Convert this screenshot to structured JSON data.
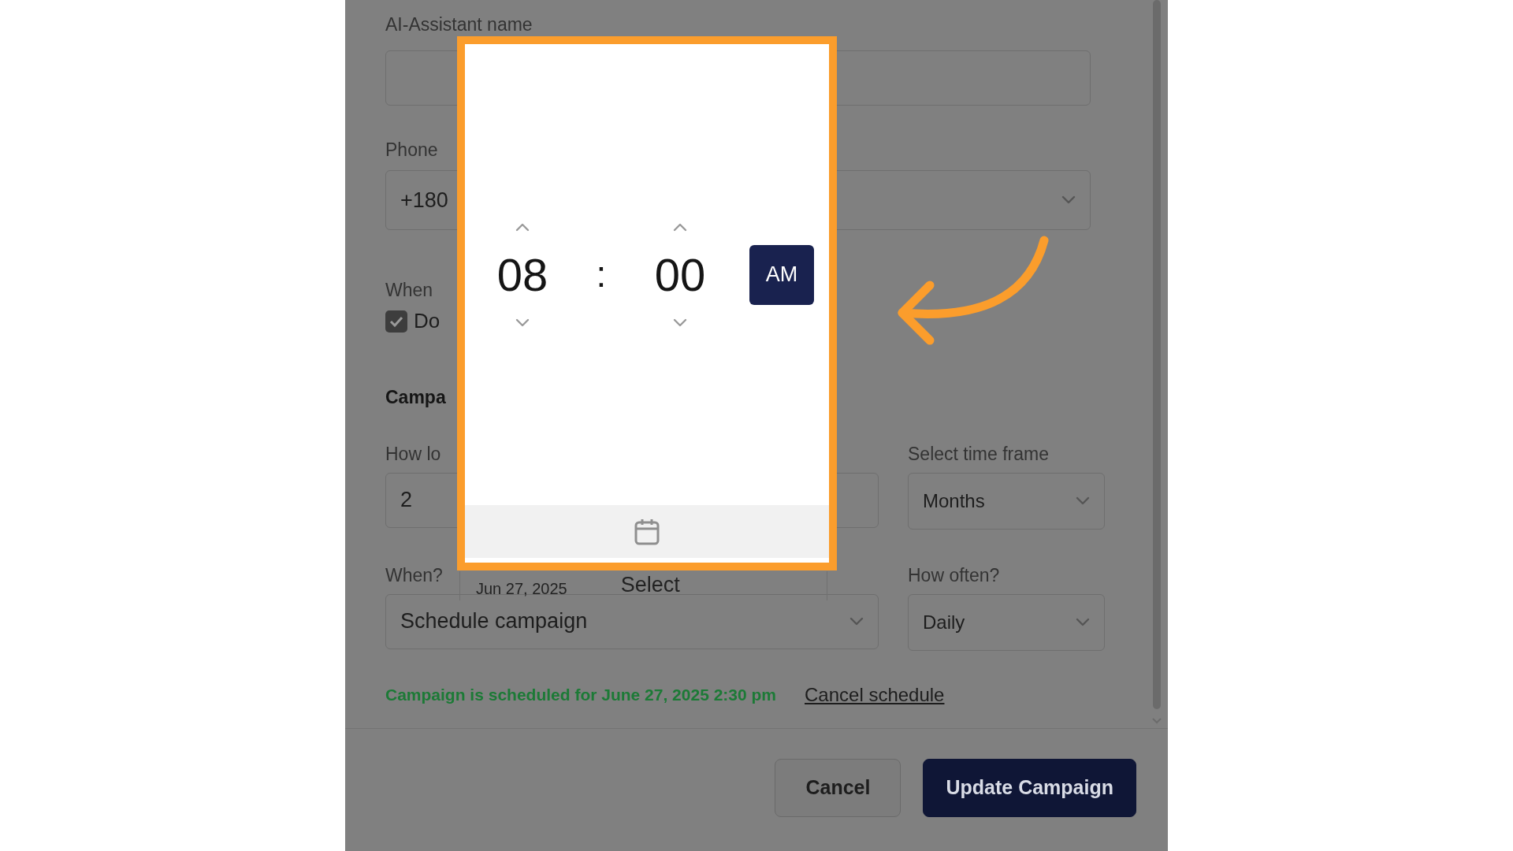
{
  "assistant_name": {
    "label": "AI-Assistant name"
  },
  "phone": {
    "label": "Phone",
    "value": "+180"
  },
  "when_v": {
    "label": "When",
    "checkbox": {
      "label": "Do",
      "checked": true
    }
  },
  "section_title": "Campa",
  "duration": {
    "label": "How lo",
    "value": "2"
  },
  "time_frame": {
    "label": "Select time frame",
    "value": "Months"
  },
  "when": {
    "label": "When?",
    "value": "Schedule campaign"
  },
  "how_often": {
    "label": "How often?",
    "value": "Daily"
  },
  "date_bar": {
    "date": "Jun 27, 2025",
    "action": "Select"
  },
  "status": {
    "message": "Campaign is scheduled for June 27, 2025 2:30 pm",
    "link": "Cancel schedule"
  },
  "buttons": [
    {
      "label": "Cancel",
      "kind": "secondary"
    },
    {
      "label": "Update Campaign",
      "kind": "primary"
    }
  ],
  "time_picker": {
    "hour": "08",
    "separator": ":",
    "minute": "00",
    "period": "AM"
  }
}
